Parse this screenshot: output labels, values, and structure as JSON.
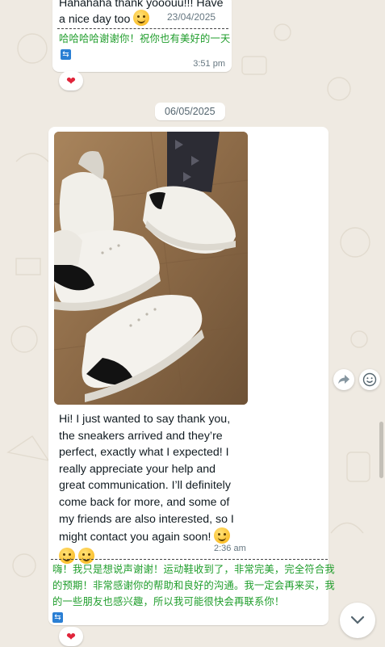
{
  "messages": {
    "first": {
      "text_line1": "Hahahaha thank yooouu!!! Have",
      "text_line2": "a nice day too",
      "inline_date": "23/04/2025",
      "translation": "哈哈哈哈谢谢你！祝你也有美好的一天",
      "time": "3:51 pm",
      "reaction": "❤"
    },
    "date_separator": "06/05/2025",
    "second": {
      "lines": [
        "Hi! I just wanted to say thank you,",
        "the sneakers arrived and they’re",
        "perfect, exactly what I expected! I",
        "really appreciate your help and",
        "great communication. I’ll definitely",
        "come back for more, and some of",
        "my friends are also interested, so I",
        "might contact you again soon!"
      ],
      "time": "2:36 am",
      "translation_lines": [
        "嗨！我只是想说声谢谢！运动鞋收到了，非常完美，完全符合我",
        "的预期！非常感谢你的帮助和良好的沟通。我一定会再来买，我",
        "的一些朋友也感兴趣，所以我可能很快会再联系你！"
      ],
      "reaction": "❤"
    }
  },
  "icons": {
    "translate": "⇆",
    "forward": "forward-icon",
    "emoji_reaction": "emoji-icon",
    "scroll_down": "chevron-down-icon"
  },
  "colors": {
    "background": "#efeae2",
    "translation_green": "#1f9d2b",
    "heart": "#e0243a"
  }
}
